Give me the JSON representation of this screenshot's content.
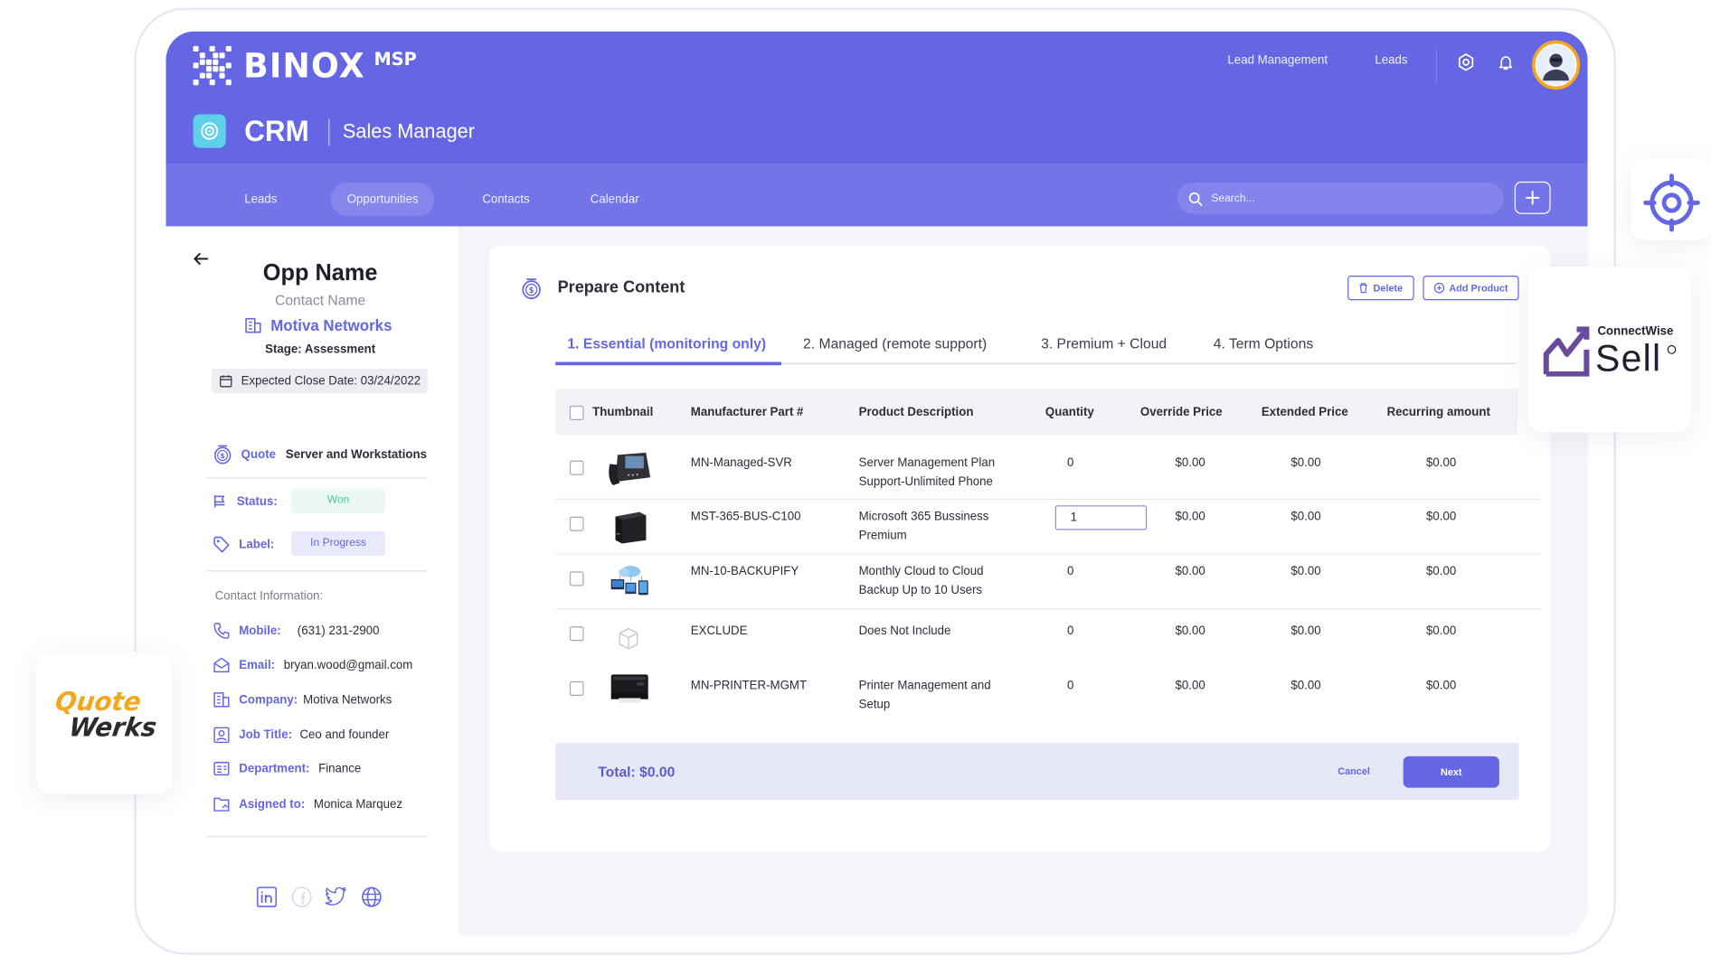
{
  "brand": {
    "name": "BINOX",
    "suffix": "MSP"
  },
  "app": {
    "title": "CRM",
    "subtitle": "Sales Manager"
  },
  "topnav": {
    "lead_management": "Lead Management",
    "leads": "Leads"
  },
  "tabs": [
    {
      "label": "Leads",
      "active": false
    },
    {
      "label": "Opportunities",
      "active": true
    },
    {
      "label": "Contacts",
      "active": false
    },
    {
      "label": "Calendar",
      "active": false
    }
  ],
  "search": {
    "placeholder": "Search..."
  },
  "opportunity": {
    "name": "Opp Name",
    "contact_name": "Contact Name",
    "company": "Motiva Networks",
    "stage": "Stage: Assessment",
    "expected_close": "Expected Close Date: 03/24/2022",
    "quote_label": "Quote",
    "quote_value": "Server and Workstations",
    "status_label": "Status:",
    "status_value": "Won",
    "label_label": "Label:",
    "label_value": "In Progress"
  },
  "contact_info": {
    "title": "Contact Information:",
    "fields": [
      {
        "label": "Mobile:",
        "value": "(631) 231-2900",
        "icon": "phone-icon"
      },
      {
        "label": "Email:",
        "value": "bryan.wood@gmail.com",
        "icon": "mail-icon"
      },
      {
        "label": "Company:",
        "value": "Motiva Networks",
        "icon": "building-icon"
      },
      {
        "label": "Job Title:",
        "value": "Ceo and founder",
        "icon": "badge-icon"
      },
      {
        "label": "Department:",
        "value": "Finance",
        "icon": "id-card-icon"
      },
      {
        "label": "Asigned to:",
        "value": "Monica Marquez",
        "icon": "assign-icon"
      }
    ]
  },
  "prepare": {
    "title": "Prepare Content",
    "delete_label": "Delete",
    "add_product_label": "Add Product",
    "steps": [
      {
        "label": "1. Essential (monitoring only)",
        "active": true
      },
      {
        "label": "2. Managed (remote support)",
        "active": false
      },
      {
        "label": "3. Premium + Cloud",
        "active": false
      },
      {
        "label": "4. Term Options",
        "active": false
      }
    ],
    "columns": [
      "Thumbnail",
      "Manufacturer Part #",
      "Product Description",
      "Quantity",
      "Override Price",
      "Extended Price",
      "Recurring amount"
    ],
    "rows": [
      {
        "part": "MN-Managed-SVR",
        "desc": [
          "Server Management Plan",
          "Support-Unlimited Phone"
        ],
        "qty": "0",
        "override": "$0.00",
        "extended": "$0.00",
        "recurring": "$0.00",
        "thumb": "phone-device"
      },
      {
        "part": "MST-365-BUS-C100",
        "desc": [
          "Microsoft 365 Bussiness",
          "Premium"
        ],
        "qty": "1",
        "override": "$0.00",
        "extended": "$0.00",
        "recurring": "$0.00",
        "thumb": "server-box"
      },
      {
        "part": "MN-10-BACKUPIFY",
        "desc": [
          "Monthly Cloud to Cloud",
          "Backup Up to 10 Users"
        ],
        "qty": "0",
        "override": "$0.00",
        "extended": "$0.00",
        "recurring": "$0.00",
        "thumb": "cloud-devices"
      },
      {
        "part": "EXCLUDE",
        "desc": [
          "Does Not Include"
        ],
        "qty": "0",
        "override": "$0.00",
        "extended": "$0.00",
        "recurring": "$0.00",
        "thumb": "empty-box"
      },
      {
        "part": "MN-PRINTER-MGMT",
        "desc": [
          "Printer Management and",
          "Setup"
        ],
        "qty": "0",
        "override": "$0.00",
        "extended": "$0.00",
        "recurring": "$0.00",
        "thumb": "printer"
      }
    ],
    "total": "Total: $0.00",
    "cancel_label": "Cancel",
    "next_label": "Next"
  },
  "partners": {
    "quotewerks": {
      "line1": "Quote",
      "line2": "Werks"
    },
    "connectwise": {
      "small": "ConnectWise",
      "big": "Sell"
    }
  },
  "colors": {
    "primary": "#6466e3",
    "tabbar": "#7374e8",
    "won": "#4ccb9a",
    "accent": "#f2a81d"
  }
}
